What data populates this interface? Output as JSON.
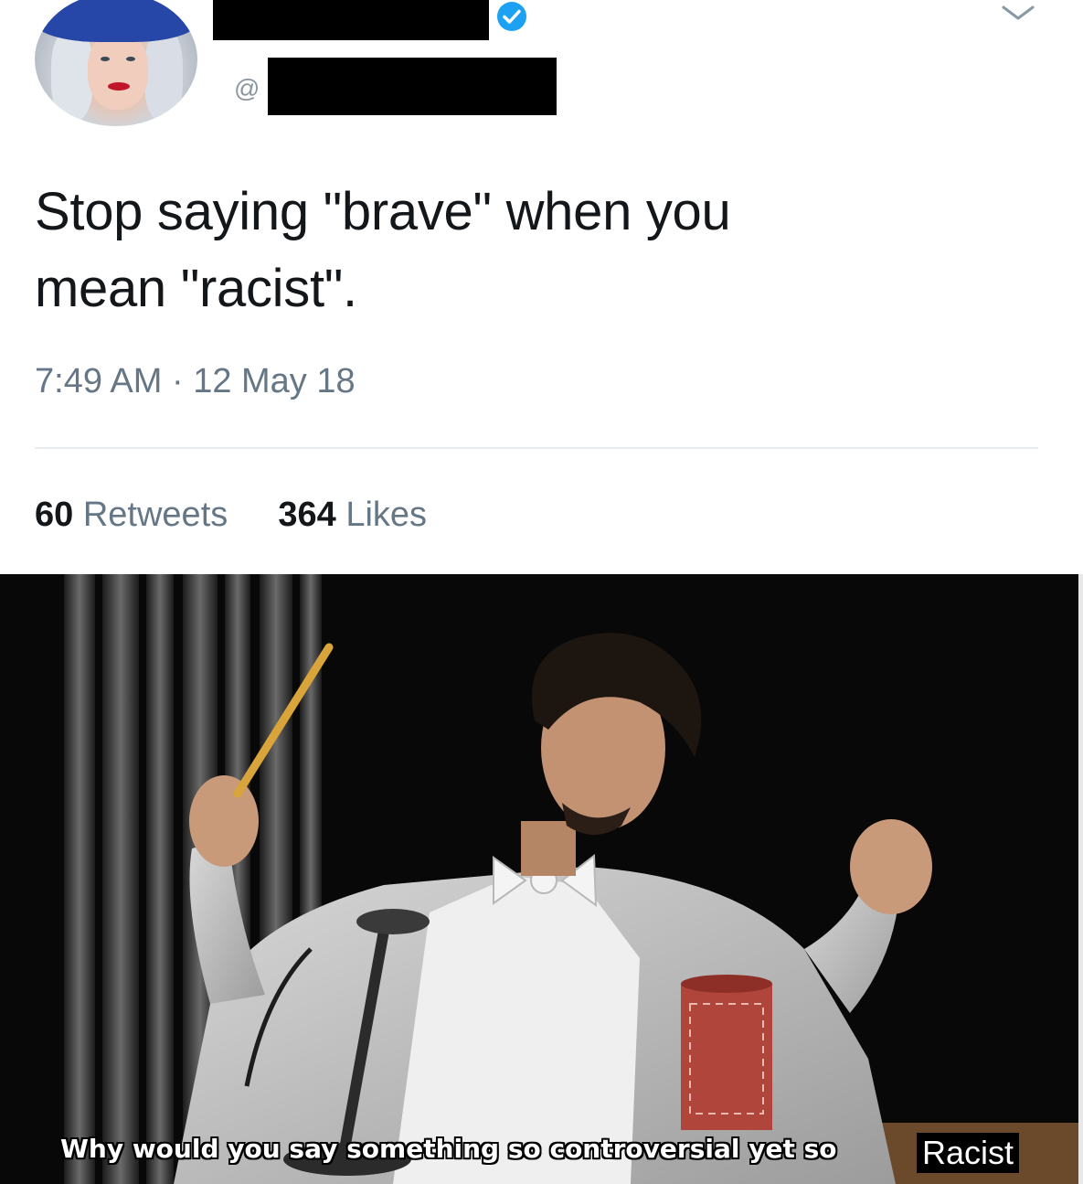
{
  "tweet": {
    "handle_prefix": "@",
    "text_lines": [
      "Stop saying \"brave\" when you",
      "mean \"racist\"."
    ],
    "timestamp": "7:49 AM · 12 May 18",
    "stats": {
      "retweets_count": "60",
      "retweets_label": "Retweets",
      "likes_count": "364",
      "likes_label": "Likes"
    },
    "icons": {
      "verified": "verified-badge-icon",
      "menu": "chevron-down-icon"
    },
    "colors": {
      "text": "#14171a",
      "muted": "#657786",
      "verified": "#1da1f2"
    }
  },
  "meme": {
    "caption": "Why would you say something so controversial yet so",
    "caption_edit": "Racist"
  }
}
